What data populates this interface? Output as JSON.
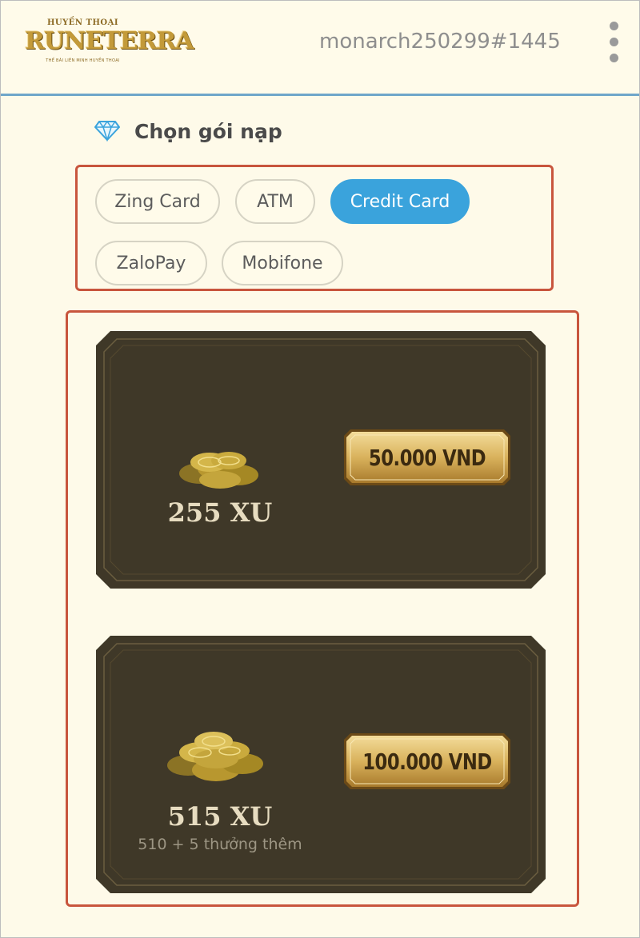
{
  "header": {
    "logo_top": "HUYỀN THOẠI",
    "logo_main": "RUNETERRA",
    "logo_sub": "THỂ BÀI LIÊN MINH HUYỀN THOẠI",
    "username": "monarch250299#1445",
    "menu_icon": "kebab-vertical-icon"
  },
  "section": {
    "title": "Chọn gói nạp",
    "icon": "diamond-icon"
  },
  "payment_methods": [
    {
      "label": "Zing Card",
      "active": false
    },
    {
      "label": "ATM",
      "active": false
    },
    {
      "label": "Credit Card",
      "active": true
    },
    {
      "label": "ZaloPay",
      "active": false
    },
    {
      "label": "Mobifone",
      "active": false
    }
  ],
  "packages": [
    {
      "amount": "255 XU",
      "bonus": "",
      "price": "50.000 VND",
      "icon": "coin-pile-icon"
    },
    {
      "amount": "515 XU",
      "bonus": "510 + 5  thưởng thêm",
      "price": "100.000 VND",
      "icon": "coin-pile-icon"
    }
  ],
  "colors": {
    "accent": "#3aa3dc",
    "highlight_border": "#c8553d",
    "card_bg": "#3f3828",
    "gold": "#c9a248",
    "page_bg": "#fefae9"
  }
}
